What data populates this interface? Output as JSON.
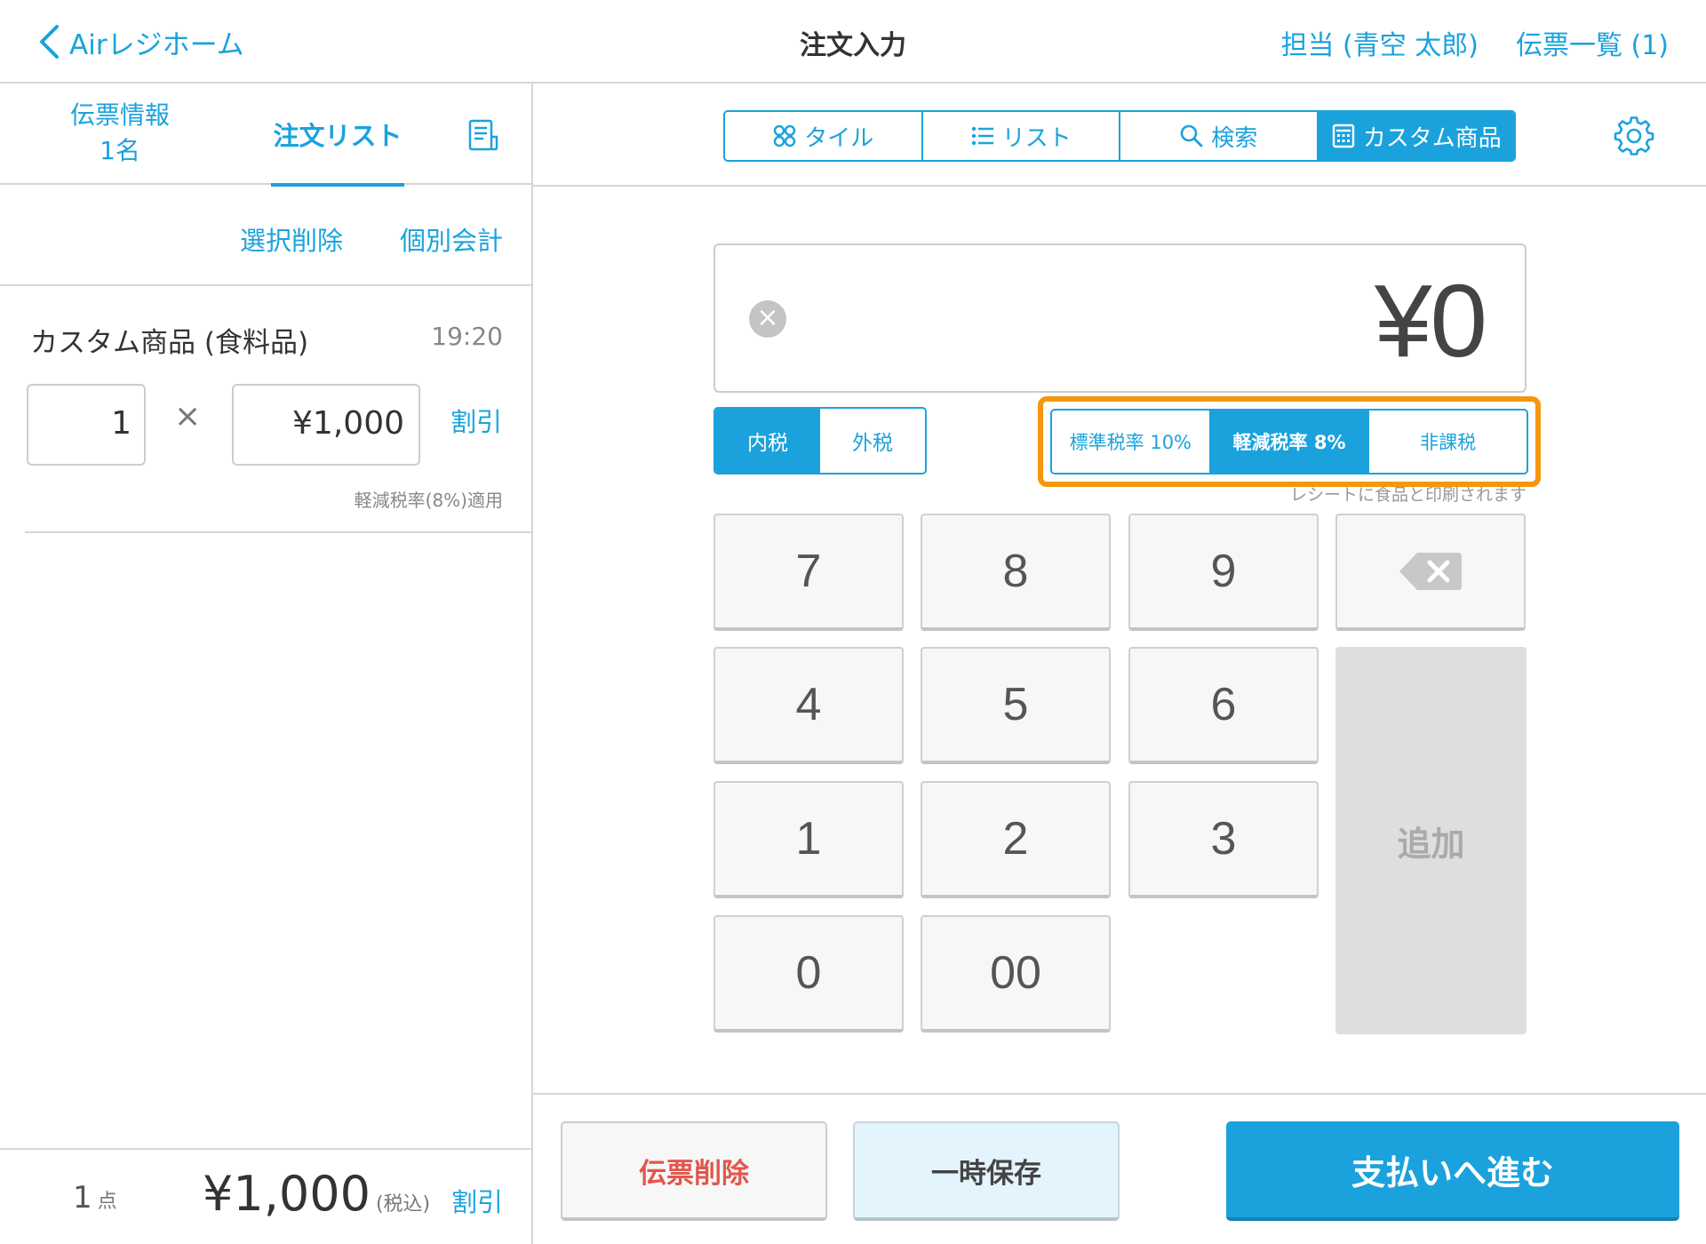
{
  "nav": {
    "back_label": "Airレジホーム",
    "title": "注文入力",
    "staff": "担当 (青空 太郎)",
    "slips": "伝票一覧 (1)"
  },
  "left": {
    "tab_info_line1": "伝票情報",
    "tab_info_line2": "1名",
    "tab_order": "注文リスト",
    "action_delete": "選択削除",
    "action_split": "個別会計",
    "item": {
      "name": "カスタム商品 (食料品)",
      "time": "19:20",
      "qty": "1",
      "times": "×",
      "price": "¥1,000",
      "discount": "割引",
      "note": "軽減税率(8%)適用"
    },
    "footer": {
      "count": "1",
      "count_unit": "点",
      "total": "¥1,000",
      "tax_note": "(税込)",
      "discount": "割引"
    }
  },
  "right": {
    "segments": [
      {
        "label": "タイル",
        "icon": "tile-icon"
      },
      {
        "label": "リスト",
        "icon": "list-icon"
      },
      {
        "label": "検索",
        "icon": "search-icon"
      },
      {
        "label": "カスタム商品",
        "icon": "calculator-icon",
        "selected": true
      }
    ],
    "amount": "¥0",
    "tax_mode": {
      "inclusive": "内税",
      "exclusive": "外税",
      "selected": "内税"
    },
    "tax_rate": {
      "standard": "標準税率 10%",
      "reduced": "軽減税率 8%",
      "exempt": "非課税",
      "selected": "軽減税率 8%",
      "note": "レシートに食品と印刷されます"
    },
    "keys": [
      "7",
      "8",
      "9",
      "4",
      "5",
      "6",
      "1",
      "2",
      "3",
      "0",
      "00"
    ],
    "add": "追加",
    "buttons": {
      "delete_slip": "伝票削除",
      "hold": "一時保存",
      "pay": "支払いへ進む"
    }
  },
  "colors": {
    "accent": "#1ba2dd",
    "highlight": "#f5960f",
    "danger": "#e2574c"
  }
}
